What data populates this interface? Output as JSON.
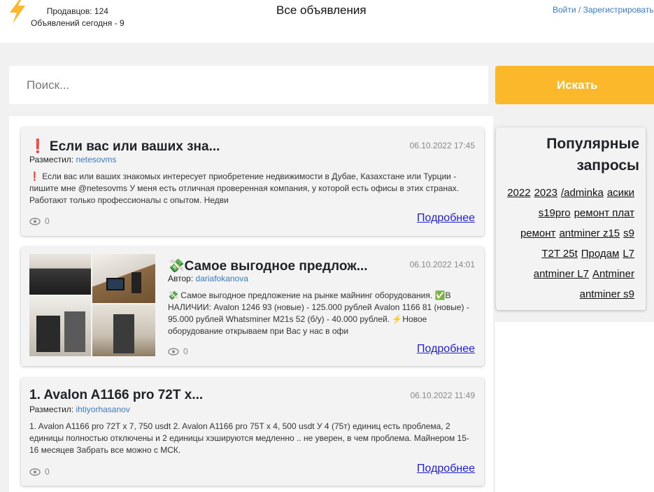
{
  "header": {
    "sellers": "Продавцов: 124",
    "ads_today": "Объявлений сегодня - 9",
    "title": "Все объявления",
    "login": "Войти",
    "separator": "/",
    "register": "Зарегистрироваться",
    "logo_icon": "lightning-icon",
    "logo_color": "#fbb82a"
  },
  "search": {
    "placeholder": "Поиск...",
    "button": "Искать",
    "accent": "#fbb82a"
  },
  "listings": [
    {
      "title": "❗ Если вас или ваших зна...",
      "date": "06.10.2022 17:45",
      "author_label": "Разместил:",
      "author": "netesovms",
      "text": "❗ Если вас или ваших знакомых интересует приобретение недвижимости в Дубае, Казахстане или Турции - пишите мне @netesovms У меня есть отличная проверенная компания, у которой есть офисы в этих странах. Работают только профессионалы с опытом. Недви",
      "views": "0",
      "more": "Подробнее"
    },
    {
      "title": "💸Самое выгодное предлож...",
      "date": "06.10.2022 14:01",
      "author_label": "Автор:",
      "author": "dariafokanova",
      "text": "💸 Самое выгодное предложение на рынке майнинг оборудования. ✅В НАЛИЧИИ: Avalon 1246 93 (новые) - 125.000 рублей Avalon 1166 81 (новые) - 95.000 рублей Whatsminer M21s 52 (б/у) - 40.000 рублей. ⚡Новое оборудование открываем при Вас у нас в офи",
      "views": "0",
      "more": "Подробнее"
    },
    {
      "title": "1. Avalon A1166 pro 72T x...",
      "date": "06.10.2022 11:49",
      "author_label": "Разместил:",
      "author": "ihtiyorhasanov",
      "text": "1. Avalon A1166 pro 72T x 7, 750 usdt 2. Avalon A1166 pro 75T x 4, 500 usdt У 4 (75т) единиц есть проблема, 2 единицы полностью отключены и 2 единицы хэшируются медленно .. не уверен, в чем проблема. Майнером 15-16 месяцев Забрать все можно с МСК.",
      "views": "0",
      "more": "Подробнее"
    }
  ],
  "popular": {
    "title": "Популярные запросы",
    "tags": [
      "2022",
      "2023",
      "/adminka",
      "асики",
      "s19pro",
      "ремонт плат",
      "ремонт",
      "antminer z15",
      "s9",
      "T2T 25t",
      "Продам",
      "L7",
      "antminer L7",
      "Antminer",
      "antminer s9"
    ]
  }
}
